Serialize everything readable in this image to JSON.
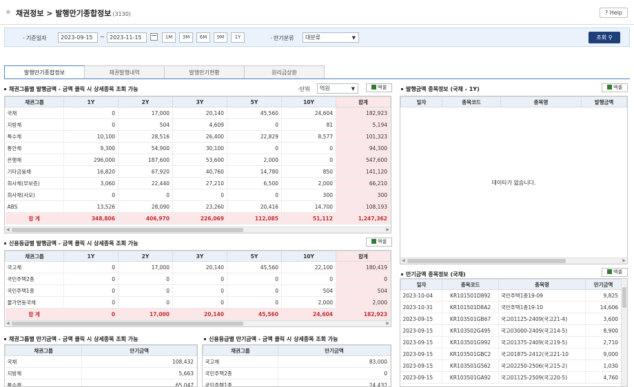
{
  "header": {
    "title": "채권정보 > 발행만기종합정보",
    "count": "(3130)",
    "help_label": "Help"
  },
  "search": {
    "date_label": "기준일자",
    "date_from": "2023-09-15",
    "date_to": "2023-11-15",
    "periods": [
      "1M",
      "3M",
      "6M",
      "9M",
      "1Y"
    ],
    "maturity_label": "만기분류",
    "maturity_value": "대분류",
    "query_label": "조회"
  },
  "tabs": [
    "발행만기종합정보",
    "채권발행내역",
    "발행만기현황",
    "원리금상환"
  ],
  "excel_label": "엑셀",
  "unit": {
    "label": "단위",
    "value": "억원"
  },
  "issue_by_group": {
    "title": "채권그룹별 발행금액 - 금액 클릭 시 상세종목 조회 가능",
    "columns": [
      "채권그룹",
      "1Y",
      "2Y",
      "3Y",
      "5Y",
      "10Y",
      "합계"
    ],
    "rows": [
      [
        "국채",
        "0",
        "17,000",
        "20,140",
        "45,560",
        "24,604",
        "182,923"
      ],
      [
        "지방채",
        "0",
        "504",
        "4,609",
        "0",
        "81",
        "5,194"
      ],
      [
        "특수채",
        "10,100",
        "28,516",
        "26,400",
        "22,829",
        "8,577",
        "101,323"
      ],
      [
        "통안채",
        "9,300",
        "54,900",
        "30,100",
        "0",
        "0",
        "94,300"
      ],
      [
        "은행채",
        "296,000",
        "187,600",
        "53,600",
        "2,000",
        "0",
        "547,600"
      ],
      [
        "기타금융채",
        "16,820",
        "67,920",
        "40,760",
        "14,780",
        "850",
        "141,120"
      ],
      [
        "회사채(무보증)",
        "3,060",
        "22,440",
        "27,210",
        "6,500",
        "2,000",
        "66,210"
      ],
      [
        "회사채(사모)",
        "0",
        "0",
        "0",
        "0",
        "300",
        "300"
      ],
      [
        "ABS",
        "13,526",
        "28,090",
        "23,260",
        "20,416",
        "14,700",
        "108,193"
      ]
    ],
    "total": [
      "합 계",
      "348,806",
      "406,970",
      "226,069",
      "112,085",
      "51,112",
      "1,247,362"
    ]
  },
  "issue_by_grade": {
    "title": "신용등급별 발행금액 - 금액 클릭 시 상세종목 조회 가능",
    "columns": [
      "채권그룹",
      "1Y",
      "2Y",
      "3Y",
      "5Y",
      "10Y",
      "합계"
    ],
    "rows": [
      [
        "국고채",
        "0",
        "17,000",
        "20,140",
        "45,560",
        "22,100",
        "180,419"
      ],
      [
        "국민주택2종",
        "0",
        "0",
        "0",
        "0",
        "0",
        "0"
      ],
      [
        "국민주택1종",
        "0",
        "0",
        "0",
        "0",
        "504",
        "504"
      ],
      [
        "물가연동국채",
        "0",
        "0",
        "0",
        "0",
        "2,000",
        "2,000"
      ]
    ],
    "total": [
      "합 계",
      "0",
      "17,000",
      "20,140",
      "45,560",
      "24,604",
      "182,923"
    ]
  },
  "maturity_by_group": {
    "title": "채권그룹별 만기금액 - 금액 클릭 시 상세종목 조회 가능",
    "columns": [
      "채권그룹",
      "만기금액"
    ],
    "rows": [
      [
        "국채",
        "108,432"
      ],
      [
        "지방채",
        "5,663"
      ],
      [
        "특수채",
        "65,047"
      ]
    ]
  },
  "maturity_by_grade": {
    "title": "신용등급별 만기금액 - 금액 클릭 시 상세종목 조회 가능",
    "columns": [
      "채권그룹",
      "만기금액"
    ],
    "rows": [
      [
        "국고채",
        "83,000"
      ],
      [
        "국민주택2종",
        "0"
      ],
      [
        "국민주택1종",
        "24,432"
      ]
    ]
  },
  "issue_items": {
    "title": "발행금액 종목정보 (국채 - 1Y)",
    "columns": [
      "일자",
      "종목코드",
      "종목명",
      "발행금액"
    ],
    "empty_text": "데이타가 없습니다."
  },
  "maturity_items": {
    "title": "만기금액 종목정보 (국채)",
    "columns": [
      "일자",
      "종목코드",
      "종목명",
      "만기금액"
    ],
    "rows": [
      [
        "2023-10-04",
        "KR101501D892",
        "국민주택1종19-09",
        "9,825"
      ],
      [
        "2023-10-31",
        "KR101501D8A2",
        "국민주택1종19-10",
        "14,606"
      ],
      [
        "2023-09-15",
        "KR103501GB67",
        "국고01125-2409(국고21-4)",
        "3,600"
      ],
      [
        "2023-09-15",
        "KR103502G495",
        "국고03000-2409(국고14-5)",
        "8,900"
      ],
      [
        "2023-09-15",
        "KR103501G992",
        "국고01375-2409(국고19-5)",
        "2,710"
      ],
      [
        "2023-09-15",
        "KR103501GBC2",
        "국고01875-2412(국고21-10",
        "9,000"
      ],
      [
        "2023-09-15",
        "KR103501G562",
        "국고02250-2506(국고15-2)",
        "1,030"
      ],
      [
        "2023-09-15",
        "KR103501GA92",
        "국고01125-2509(국고20-5)",
        "4,760"
      ]
    ]
  }
}
